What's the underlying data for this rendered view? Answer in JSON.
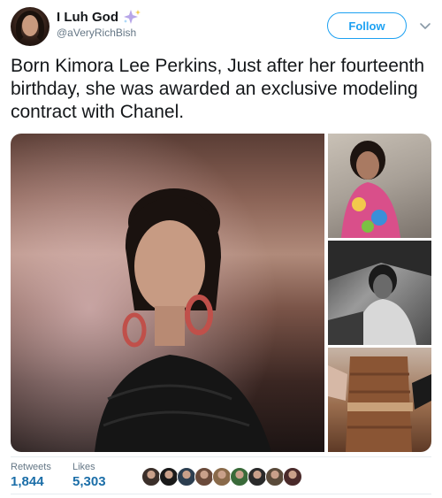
{
  "author": {
    "display_name": "I Luh God",
    "handle": "@aVeryRichBish",
    "name_emoji_icon": "sparkles-icon"
  },
  "actions": {
    "follow_label": "Follow",
    "more_icon": "chevron-down-icon"
  },
  "tweet": {
    "text": "Born Kimora Lee Perkins, Just after her fourteenth birthday, she was awarded an exclusive modeling contract with Chanel."
  },
  "media": {
    "photos": [
      "photo-main",
      "photo-top-right",
      "photo-middle-right",
      "photo-bottom-right"
    ]
  },
  "stats": {
    "retweets_label": "Retweets",
    "retweets_value": "1,844",
    "likes_label": "Likes",
    "likes_value": "5,303"
  },
  "likers": {
    "count_shown": 9,
    "colors": [
      "#3b2f2a",
      "#1a1a1a",
      "#2c3e50",
      "#6a4a3a",
      "#8a6a4a",
      "#3a6a3a",
      "#2a2a2a",
      "#5a4a3a",
      "#4a2a2a"
    ]
  },
  "colors": {
    "accent": "#1da1f2",
    "stat_value": "#1b6ea8",
    "secondary_text": "#657786"
  }
}
